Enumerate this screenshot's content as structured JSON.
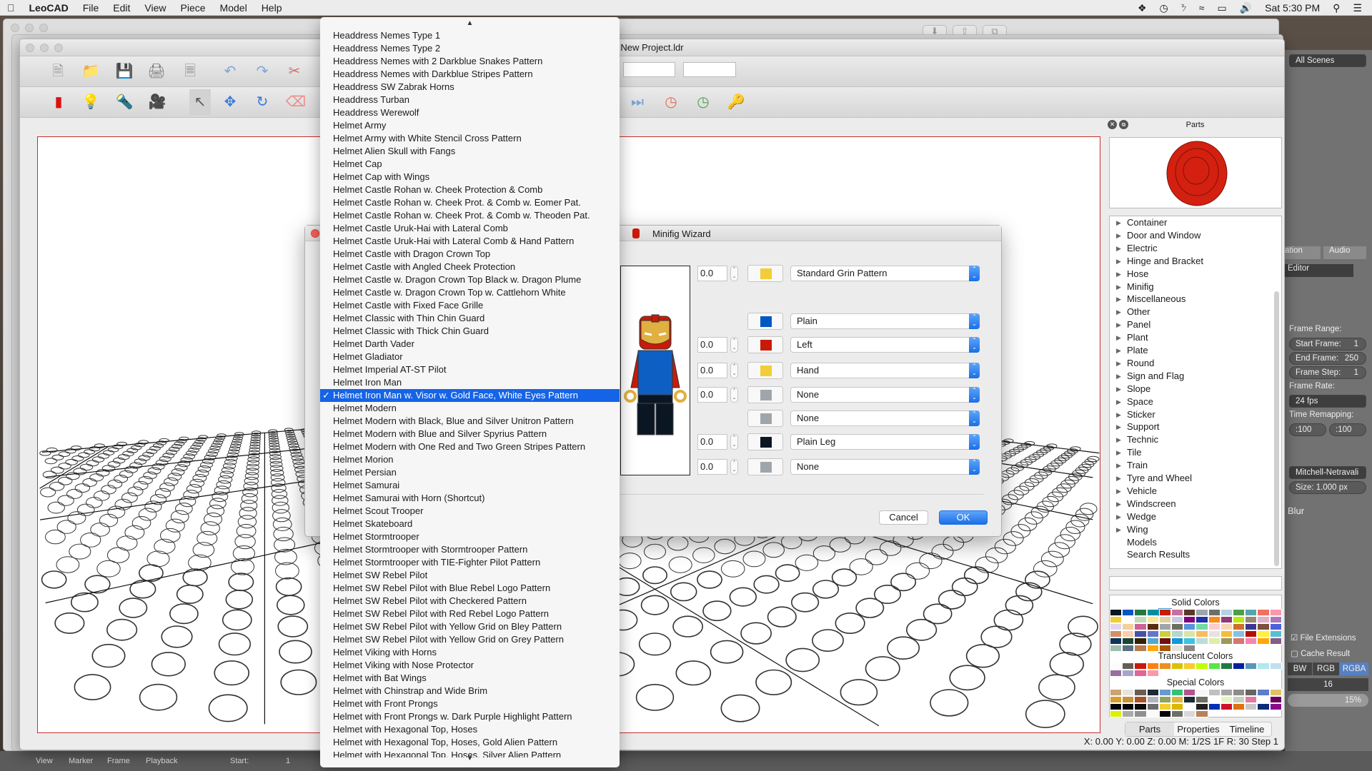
{
  "menubar": {
    "app": "LeoCAD",
    "items": [
      "File",
      "Edit",
      "View",
      "Piece",
      "Model",
      "Help"
    ],
    "clock": "Sat 5:30 PM",
    "status_icons": [
      "dropbox-icon",
      "time-machine-icon",
      "bluetooth-icon",
      "wifi-icon",
      "airplay-icon",
      "volume-icon"
    ]
  },
  "window": {
    "title": "New Project.ldr"
  },
  "blender": {
    "scene": "All Scenes",
    "tab_partial": "ation",
    "audio": "Audio",
    "editor": "Editor",
    "frame_range": "Frame Range:",
    "start_frame": "Start Frame:",
    "start_value": "1",
    "end_frame": "End Frame:",
    "end_value": "250",
    "frame_step": "Frame Step:",
    "step_value": "1",
    "frame_rate": "Frame Rate:",
    "fps": "24 fps",
    "time_remap": "Time Remapping:",
    "remap_old": ":100",
    "remap_new": ":100",
    "filter": "Mitchell-Netravali",
    "size": "Size:",
    "size_value": "1.000 px",
    "blur": "Blur",
    "file_ext": "File Extensions",
    "cache": "Cache Result",
    "bw": "BW",
    "rgb": "RGB",
    "rgba": "RGBA",
    "depth": "16",
    "percent": "15%",
    "timeline": {
      "view": "View",
      "marker": "Marker",
      "frame": "Frame",
      "playback": "Playback",
      "start": "Start:",
      "start_value": "1"
    }
  },
  "dialog": {
    "title": "Minifig Wizard",
    "cancel": "Cancel",
    "ok": "OK",
    "rows": [
      {
        "angle": "0.0",
        "color": "#f2cd37",
        "value": "Standard Grin Pattern"
      },
      {
        "angle": null,
        "color": "#0057c2",
        "value": "Plain"
      },
      {
        "angle": "0.0",
        "color": "#c91a09",
        "value": "Left"
      },
      {
        "angle": "0.0",
        "color": "#f2cd37",
        "value": "Hand"
      },
      {
        "angle": "0.0",
        "color": "#a0a5a9",
        "value": "None"
      },
      {
        "angle": null,
        "color": "#a0a5a9",
        "value": "None"
      },
      {
        "angle": "0.0",
        "color": "#0b1623",
        "value": "Plain Leg"
      },
      {
        "angle": "0.0",
        "color": "#a0a5a9",
        "value": "None"
      }
    ]
  },
  "dropdown": {
    "selected": "Helmet Iron Man w. Visor w. Gold Face, White Eyes Pattern",
    "items": [
      "Headdress Nemes Type 1",
      "Headdress Nemes Type 2",
      "Headdress Nemes with 2 Darkblue Snakes Pattern",
      "Headdress Nemes with Darkblue Stripes Pattern",
      "Headdress SW Zabrak Horns",
      "Headdress Turban",
      "Headdress Werewolf",
      "Helmet Army",
      "Helmet Army with White Stencil Cross Pattern",
      "Helmet Alien Skull with Fangs",
      "Helmet Cap",
      "Helmet Cap with Wings",
      "Helmet Castle Rohan w. Cheek Protection & Comb",
      "Helmet Castle Rohan w. Cheek Prot. & Comb w. Eomer Pat.",
      "Helmet Castle Rohan w. Cheek Prot. & Comb w. Theoden Pat.",
      "Helmet Castle Uruk-Hai with Lateral Comb",
      "Helmet Castle Uruk-Hai with Lateral Comb & Hand Pattern",
      "Helmet Castle with Dragon Crown Top",
      "Helmet Castle with Angled Cheek Protection",
      "Helmet Castle w. Dragon Crown Top Black w. Dragon Plume",
      "Helmet Castle w. Dragon Crown Top w. Cattlehorn White",
      "Helmet Castle with Fixed Face Grille",
      "Helmet Classic with Thin Chin Guard",
      "Helmet Classic with Thick Chin Guard",
      "Helmet Darth Vader",
      "Helmet Gladiator",
      "Helmet Imperial AT-ST Pilot",
      "Helmet Iron Man",
      "Helmet Iron Man w. Visor w. Gold Face, White Eyes Pattern",
      "Helmet Modern",
      "Helmet Modern with Black, Blue and Silver Unitron Pattern",
      "Helmet Modern with Blue and Silver Spyrius Pattern",
      "Helmet Modern with One Red and Two Green Stripes Pattern",
      "Helmet Morion",
      "Helmet Persian",
      "Helmet Samurai",
      "Helmet Samurai with Horn (Shortcut)",
      "Helmet Scout Trooper",
      "Helmet Skateboard",
      "Helmet Stormtrooper",
      "Helmet Stormtrooper with Stormtrooper Pattern",
      "Helmet Stormtrooper with TIE-Fighter Pilot Pattern",
      "Helmet SW Rebel Pilot",
      "Helmet SW Rebel Pilot with Blue Rebel Logo Pattern",
      "Helmet SW Rebel Pilot with Checkered Pattern",
      "Helmet SW Rebel Pilot with Red Rebel Logo Pattern",
      "Helmet SW Rebel Pilot with Yellow Grid on Bley Pattern",
      "Helmet SW Rebel Pilot with Yellow Grid on Grey Pattern",
      "Helmet Viking with Horns",
      "Helmet Viking with Nose Protector",
      "Helmet with Bat Wings",
      "Helmet with Chinstrap and Wide Brim",
      "Helmet with Front Prongs",
      "Helmet with Front Prongs w. Dark Purple Highlight Pattern",
      "Helmet with Hexagonal Top, Hoses",
      "Helmet with Hexagonal Top, Hoses, Gold Alien Pattern",
      "Helmet with Hexagonal Top, Hoses, Silver Alien Pattern"
    ]
  },
  "parts": {
    "title": "Parts",
    "categories": [
      "Container",
      "Door and Window",
      "Electric",
      "Hinge and Bracket",
      "Hose",
      "Minifig",
      "Miscellaneous",
      "Other",
      "Panel",
      "Plant",
      "Plate",
      "Round",
      "Sign and Flag",
      "Slope",
      "Space",
      "Sticker",
      "Support",
      "Technic",
      "Tile",
      "Train",
      "Tyre and Wheel",
      "Vehicle",
      "Windscreen",
      "Wedge",
      "Wing",
      "Models",
      "Search Results"
    ],
    "expandable_count": 25,
    "solid_title": "Solid Colors",
    "translucent_title": "Translucent Colors",
    "special_title": "Special Colors",
    "selected_color": "#c91a09",
    "solid": [
      "#0b1623",
      "#0057c2",
      "#237841",
      "#008f9b",
      "#c91a09",
      "#c870a0",
      "#583927",
      "#a0a5a9",
      "#6c6e68",
      "#b4d2e3",
      "#4b9f4a",
      "#55a5af",
      "#f2705e",
      "#fc97ac",
      "#f2cd37",
      "#ffffff",
      "#c2dab8",
      "#fbe696",
      "#e4cd9e",
      "#c9cae2",
      "#81007b",
      "#2032b0",
      "#fe8a18",
      "#923978",
      "#bbe90b",
      "#958a73",
      "#e4adc8",
      "#ac78ba",
      "#e1d5ed",
      "#f3cf9b",
      "#cd6298",
      "#582a12",
      "#a0a5a9",
      "#6d6e5c",
      "#5a93db",
      "#73dca1",
      "#fecccf",
      "#f6d7b3",
      "#cc702a",
      "#3f3691",
      "#7c503a",
      "#4c61db",
      "#d09168",
      "#feccb0",
      "#4354a3",
      "#6874ca",
      "#c7d23c",
      "#b3d7d1",
      "#d9e4a7",
      "#f9ba61",
      "#e6e3e0",
      "#f8bb3d",
      "#86c1e1",
      "#b31004",
      "#fff03a",
      "#56bed6",
      "#0d325b",
      "#184632",
      "#352100",
      "#54a9c8",
      "#720e0f",
      "#1498d7",
      "#3ec2dd",
      "#bddcd8",
      "#dfeea5",
      "#9b9a5a",
      "#d67572",
      "#f785b1",
      "#ffa70b",
      "#845e84",
      "#a0bcac",
      "#597184",
      "#b67b50",
      "#ffa70b",
      "#a95500",
      "#e6e3da",
      "#898788"
    ],
    "translucent": [
      "#fcfcfc",
      "#635f52",
      "#c91a09",
      "#ff800d",
      "#f08f1c",
      "#ddc000",
      "#f5cd2f",
      "#c0ff00",
      "#56e646",
      "#237841",
      "#0020a0",
      "#559ab7",
      "#aee9ef",
      "#c1dff0",
      "#96709f",
      "#a5a5cb",
      "#df6695",
      "#fc97ac"
    ],
    "special": [
      "#cca373",
      "#e5e4de",
      "#6a5e54",
      "#1b2a34",
      "#6b98d0",
      "#35c07a",
      "#b0558e",
      "#f6f6f6",
      "#c0c0c0",
      "#a4a4a4",
      "#8c8c8c",
      "#646464",
      "#5c7dc8",
      "#e0c26a",
      "#d4a02b",
      "#c6923b",
      "#a5532a",
      "#b0b4c0",
      "#8fa45c",
      "#e5b43b",
      "#1b2a34",
      "#6b7060",
      "#ffffff",
      "#e4f6c0",
      "#c8d0c0",
      "#e07aa0",
      "#ffffff",
      "#6c005c",
      "#050505",
      "#050505",
      "#0a0a0a",
      "#6c6c6c",
      "#f5cd2f",
      "#d8b800",
      "#ffffff",
      "#202020",
      "#0032b0",
      "#d0102c",
      "#e07010",
      "#c8c8c8",
      "#0a2a7a",
      "#8a0a8a",
      "#dcf000",
      "#aaaaaa",
      "#909090",
      "#fafafa",
      "#050505",
      "#6e6e64",
      "#d8d8d8",
      "#b8805c"
    ],
    "tabs": [
      "Parts",
      "Properties",
      "Timeline"
    ],
    "active_tab": "Parts"
  },
  "status": "X: 0.00 Y: 0.00 Z: 0.00   M: 1/2S 1F R: 30   Step 1"
}
